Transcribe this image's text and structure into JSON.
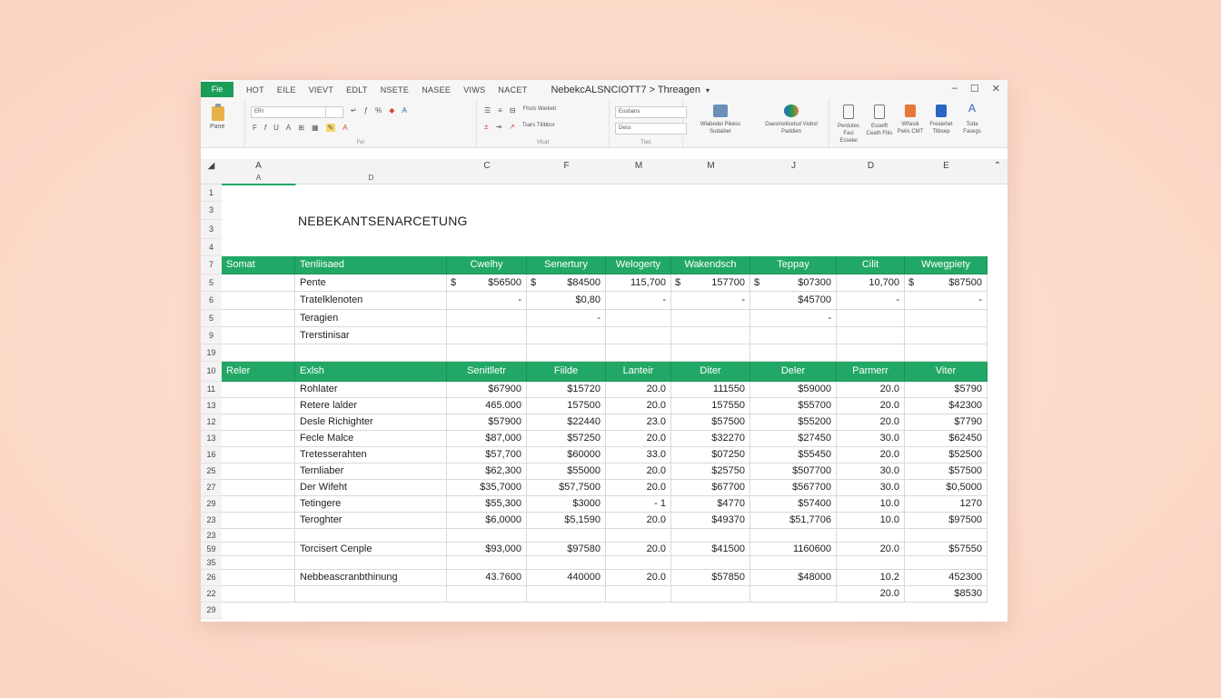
{
  "menubar": {
    "file_tab": "Fie",
    "items": [
      "HOT",
      "EILE",
      "VIEVT",
      "EDLT",
      "NSETE",
      "NASEE",
      "VIWS",
      "NACET"
    ],
    "doc_title": "NebekcALSNCIOTT7 > Threagen",
    "arrow": "▾",
    "controls": [
      "–",
      "☐",
      "✕"
    ]
  },
  "ribbon": {
    "paste_label": "Pane",
    "font_box": "ERI",
    "number_box": "Eosbans",
    "number_box2": "Dess",
    "style_a": "Fhsts Warkeit",
    "style_b": "Tsars Ttilbbor",
    "groups": {
      "font": "Fer",
      "alignment": "Vlcat",
      "number": "Ttec"
    },
    "big_buttons": [
      {
        "label": "Wlabedel Pikess Sudaiber",
        "icon": "insert-chart-icon"
      },
      {
        "label": "Daesmeticetsd Viobsl Paddien",
        "icon": "recycle-icon"
      }
    ],
    "cells_buttons": [
      {
        "label": "Perdutec Fasi Esselei"
      },
      {
        "label": "Esselft Ceath Ftiis"
      },
      {
        "label": "Wfiasik Pwiis CMT"
      },
      {
        "label": "Freaiehet Tilbsep"
      },
      {
        "label": "Toda Fasegs"
      }
    ]
  },
  "sheet": {
    "columns": [
      "A",
      "",
      "C",
      "F",
      "M",
      "M",
      "J",
      "D",
      "E"
    ],
    "subcolumns": [
      "A",
      "D"
    ],
    "title": "NEBEKANTSENARCETUNG",
    "row_numbers": [
      "1",
      "3",
      "3",
      "4",
      "7",
      "5",
      "6",
      "5",
      "9",
      "19",
      "10",
      "11",
      "13",
      "12",
      "13",
      "16",
      "25",
      "27",
      "29",
      "23",
      "23",
      "59",
      "35",
      "26",
      "22",
      "29"
    ],
    "header1": [
      "Somat",
      "Tenliisaed",
      "Cwelhy",
      "Senertury",
      "Welogerty",
      "Wakendsch",
      "Teppay",
      "Cilit",
      "Wwegpiety"
    ],
    "block1": [
      [
        "",
        "Pente",
        "$",
        "$56500",
        "$",
        "$84500",
        "115,700",
        "$",
        "157700",
        "$",
        "$07300",
        "10,700",
        "$",
        "$87500"
      ],
      [
        "",
        "Tratelklenoten",
        "",
        "-",
        "",
        "$0,80",
        "-",
        "",
        "-",
        "",
        "$45700",
        "-",
        "",
        "-"
      ],
      [
        "",
        "Teragien",
        "",
        "",
        "",
        "-",
        "",
        "",
        "",
        "",
        "-",
        "",
        "",
        ""
      ],
      [
        "",
        "Trerstinisar",
        "",
        "",
        "",
        "",
        "",
        "",
        "",
        "",
        "",
        "",
        "",
        ""
      ]
    ],
    "header2": [
      "Reler",
      "Exlsh",
      "Senitlletr",
      "Fiilde",
      "Lanteir",
      "Diter",
      "Deler",
      "Parmerr",
      "Viter"
    ],
    "block2": [
      [
        "Rohlater",
        "$67900",
        "$15720",
        "20.0",
        "111550",
        "$59000",
        "20.0",
        "$5790"
      ],
      [
        "Retere lalder",
        "465.000",
        "157500",
        "20.0",
        "157550",
        "$55700",
        "20.0",
        "$42300"
      ],
      [
        "Desle Richighter",
        "$57900",
        "$22440",
        "23.0",
        "$57500",
        "$55200",
        "20.0",
        "$7790"
      ],
      [
        "Fecle Malce",
        "$87,000",
        "$57250",
        "20.0",
        "$32270",
        "$27450",
        "30.0",
        "$62450"
      ],
      [
        "Tretesserahten",
        "$57,700",
        "$60000",
        "33.0",
        "$07250",
        "$55450",
        "20.0",
        "$52500"
      ],
      [
        "Ternliaber",
        "$62,300",
        "$55000",
        "20.0",
        "$25750",
        "$507700",
        "30.0",
        "$57500"
      ],
      [
        "Der Wifeht",
        "$35,7000",
        "$57,7500",
        "20.0",
        "$67700",
        "$567700",
        "30.0",
        "$0,5000"
      ],
      [
        "Tetingere",
        "$55,300",
        "$3000",
        "- 1",
        "$4770",
        "$57400",
        "10.0",
        "1270"
      ],
      [
        "Teroghter",
        "$6,0000",
        "$5,1590",
        "20.0",
        "$49370",
        "$51,7706",
        "10.0",
        "$97500"
      ]
    ],
    "total1": [
      "Torcisert Cenple",
      "$93,000",
      "$97580",
      "20.0",
      "$41500",
      "1160600",
      "20.0",
      "$57550"
    ],
    "total2": [
      "Nebbeascranbthinung",
      "43.7600",
      "440000",
      "20.0",
      "$57850",
      "$48000",
      "10.2",
      "452300"
    ],
    "final": [
      "20.0",
      "$8530"
    ]
  },
  "colors": {
    "accent": "#22a866",
    "background": "#fbd3c1"
  }
}
